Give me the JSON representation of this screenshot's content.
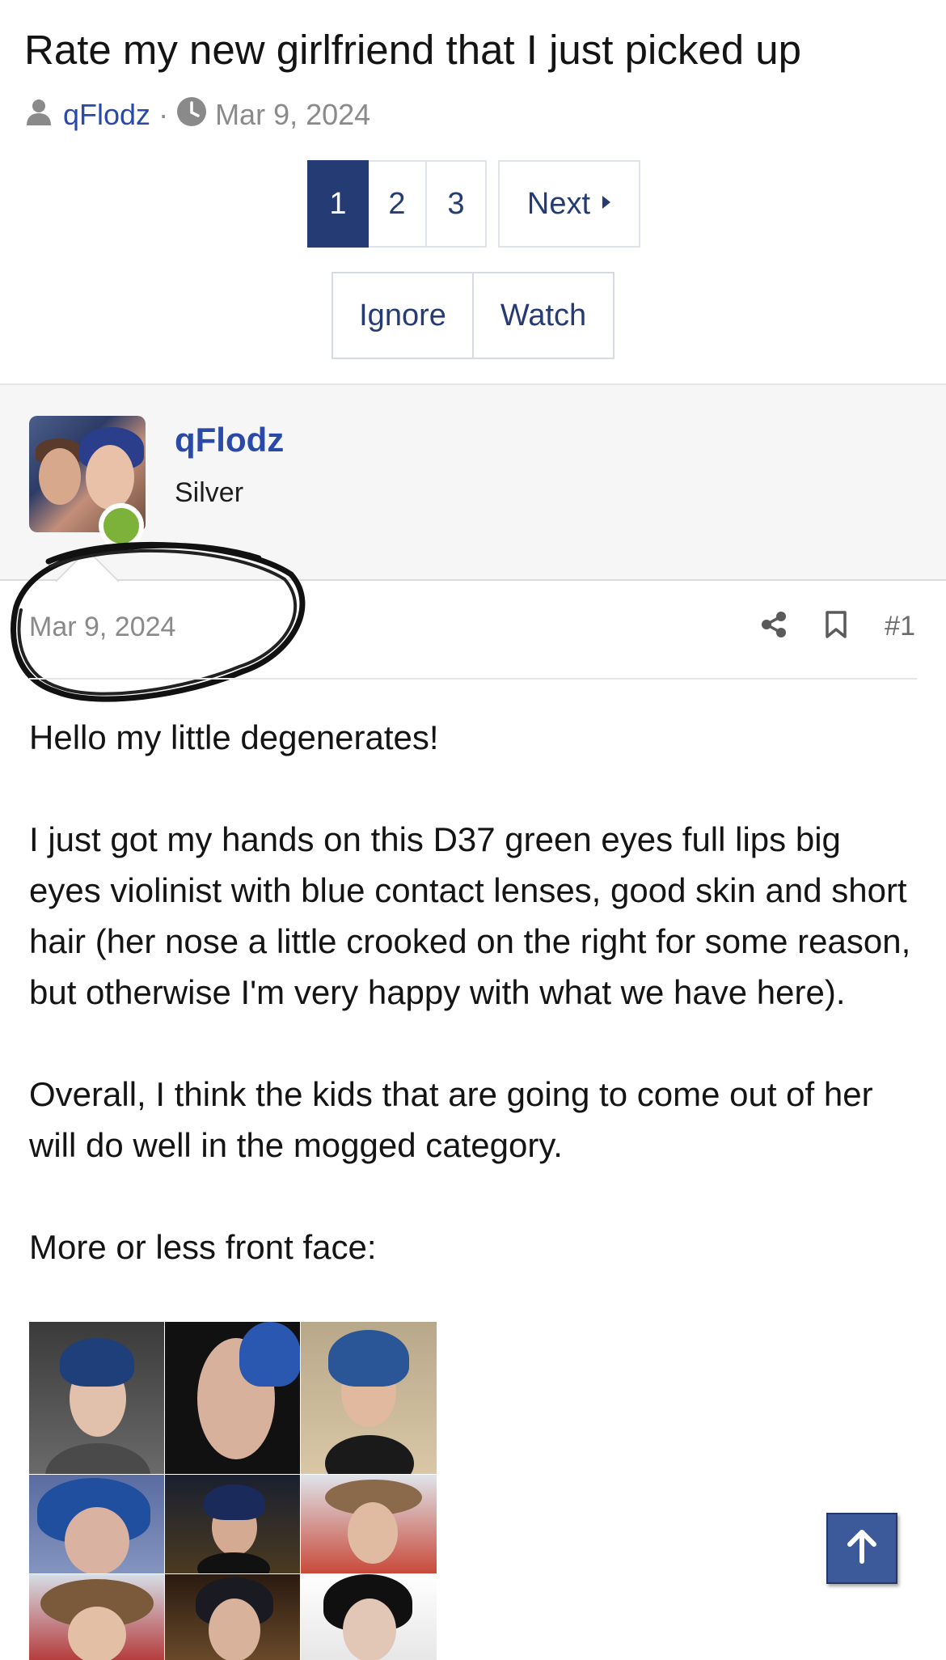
{
  "thread": {
    "title": "Rate my new girlfriend that I just picked up",
    "author": "qFlodz",
    "separator": "·",
    "date": "Mar 9, 2024"
  },
  "pagination": {
    "pages": [
      "1",
      "2",
      "3"
    ],
    "current": "1",
    "next_label": "Next"
  },
  "thread_actions": {
    "ignore_label": "Ignore",
    "watch_label": "Watch"
  },
  "post": {
    "username": "qFlodz",
    "user_title": "Silver",
    "online": true,
    "date": "Mar 9, 2024",
    "number": "#1",
    "paragraphs": [
      "Hello my little degenerates!",
      "I just got my hands on this D37 green eyes full lips big eyes violinist with blue contact lenses, good skin and short hair (her nose a little crooked on the right for some reason, but otherwise I'm very happy with what we have here).",
      "Overall, I think the kids that are going to come out of her will do well in the mogged category.",
      "More or less front face:"
    ]
  },
  "icons": {
    "author": "user-icon",
    "date": "clock-icon",
    "next": "caret-right-icon",
    "share": "share-icon",
    "bookmark": "bookmark-icon",
    "scroll_top": "arrow-up-icon"
  },
  "colors": {
    "link": "#2a4aa8",
    "accent": "#253b73",
    "online": "#7cb13a",
    "scroll_button": "#3c5a9a"
  }
}
